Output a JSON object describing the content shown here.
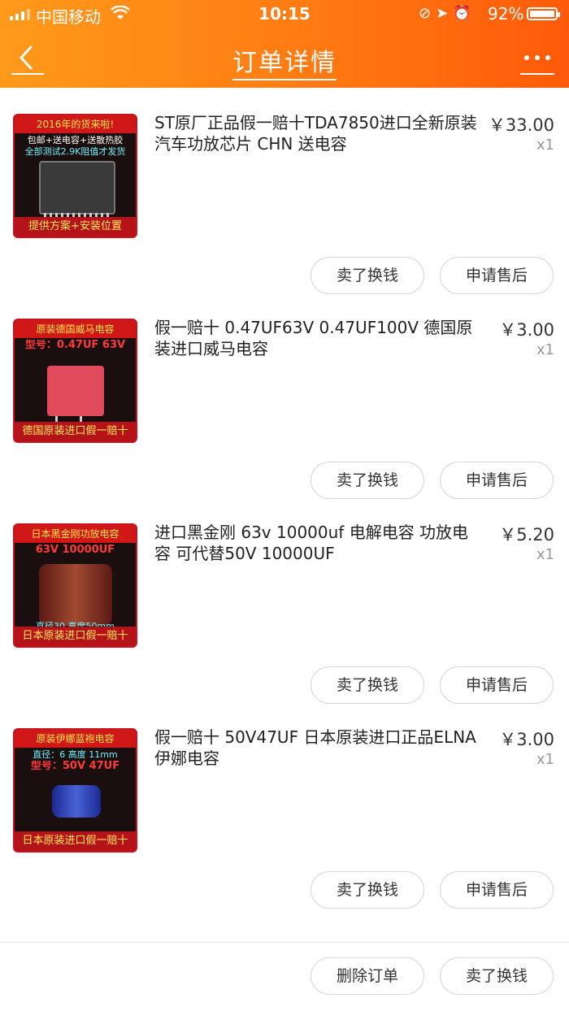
{
  "status_bar": {
    "carrier": "中国移动",
    "time": "10:15",
    "battery": "92%"
  },
  "nav": {
    "title": "订单详情"
  },
  "items": [
    {
      "title": "ST原厂正品假一赔十TDA7850进口全新原装汽车功放芯片 CHN 送电容",
      "price": "￥33.00",
      "qty": "x1",
      "sell_label": "卖了换钱",
      "after_sale_label": "申请售后",
      "thumb_top": "2016年的货来啦!",
      "thumb_sub": "包邮+送电容+送散热胶",
      "thumb_sub2": "全部测试2.9K阻值才发货",
      "thumb_bottom": "提供方案+安装位置"
    },
    {
      "title": "假一赔十 0.47UF63V 0.47UF100V 德国原装进口威马电容",
      "price": "￥3.00",
      "qty": "x1",
      "sell_label": "卖了换钱",
      "after_sale_label": "申请售后",
      "thumb_top": "原装德国威马电容",
      "thumb_sub": "型号：0.47UF 63V",
      "thumb_sub2": "",
      "thumb_bottom": "德国原装进口假一赔十"
    },
    {
      "title": "进口黑金刚 63v 10000uf 电解电容 功放电容 可代替50V 10000UF",
      "price": "￥5.20",
      "qty": "x1",
      "sell_label": "卖了换钱",
      "after_sale_label": "申请售后",
      "thumb_top": "日本黑金刚功放电容",
      "thumb_sub": "63V 10000UF",
      "thumb_sub2": "直径30 高度50mm",
      "thumb_bottom": "日本原装进口假一赔十"
    },
    {
      "title": "假一赔十 50V47UF 日本原装进口正品ELNA伊娜电容",
      "price": "￥3.00",
      "qty": "x1",
      "sell_label": "卖了换钱",
      "after_sale_label": "申请售后",
      "thumb_top": "原装伊娜蓝袍电容",
      "thumb_sub": "型号：50V 47UF",
      "thumb_sub2": "直径：6 高度 11mm",
      "thumb_bottom": "日本原装进口假一赔十"
    }
  ],
  "footer": {
    "delete_label": "删除订单",
    "sell_label": "卖了换钱"
  }
}
